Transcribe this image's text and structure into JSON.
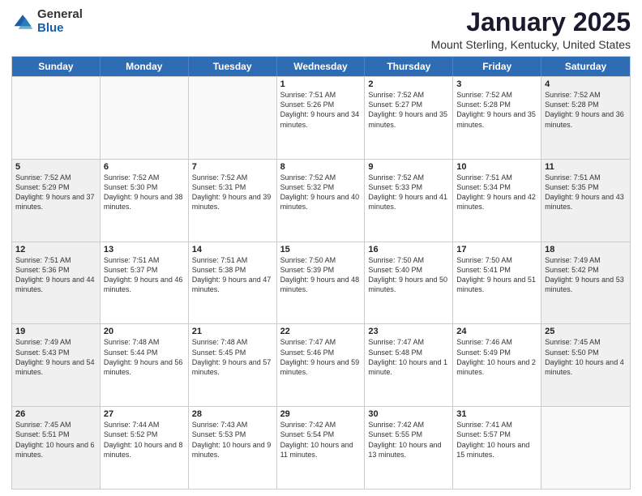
{
  "logo": {
    "general": "General",
    "blue": "Blue"
  },
  "title": "January 2025",
  "subtitle": "Mount Sterling, Kentucky, United States",
  "days": [
    "Sunday",
    "Monday",
    "Tuesday",
    "Wednesday",
    "Thursday",
    "Friday",
    "Saturday"
  ],
  "weeks": [
    [
      {
        "day": "",
        "text": ""
      },
      {
        "day": "",
        "text": ""
      },
      {
        "day": "",
        "text": ""
      },
      {
        "day": "1",
        "text": "Sunrise: 7:51 AM\nSunset: 5:26 PM\nDaylight: 9 hours and 34 minutes."
      },
      {
        "day": "2",
        "text": "Sunrise: 7:52 AM\nSunset: 5:27 PM\nDaylight: 9 hours and 35 minutes."
      },
      {
        "day": "3",
        "text": "Sunrise: 7:52 AM\nSunset: 5:28 PM\nDaylight: 9 hours and 35 minutes."
      },
      {
        "day": "4",
        "text": "Sunrise: 7:52 AM\nSunset: 5:28 PM\nDaylight: 9 hours and 36 minutes."
      }
    ],
    [
      {
        "day": "5",
        "text": "Sunrise: 7:52 AM\nSunset: 5:29 PM\nDaylight: 9 hours and 37 minutes."
      },
      {
        "day": "6",
        "text": "Sunrise: 7:52 AM\nSunset: 5:30 PM\nDaylight: 9 hours and 38 minutes."
      },
      {
        "day": "7",
        "text": "Sunrise: 7:52 AM\nSunset: 5:31 PM\nDaylight: 9 hours and 39 minutes."
      },
      {
        "day": "8",
        "text": "Sunrise: 7:52 AM\nSunset: 5:32 PM\nDaylight: 9 hours and 40 minutes."
      },
      {
        "day": "9",
        "text": "Sunrise: 7:52 AM\nSunset: 5:33 PM\nDaylight: 9 hours and 41 minutes."
      },
      {
        "day": "10",
        "text": "Sunrise: 7:51 AM\nSunset: 5:34 PM\nDaylight: 9 hours and 42 minutes."
      },
      {
        "day": "11",
        "text": "Sunrise: 7:51 AM\nSunset: 5:35 PM\nDaylight: 9 hours and 43 minutes."
      }
    ],
    [
      {
        "day": "12",
        "text": "Sunrise: 7:51 AM\nSunset: 5:36 PM\nDaylight: 9 hours and 44 minutes."
      },
      {
        "day": "13",
        "text": "Sunrise: 7:51 AM\nSunset: 5:37 PM\nDaylight: 9 hours and 46 minutes."
      },
      {
        "day": "14",
        "text": "Sunrise: 7:51 AM\nSunset: 5:38 PM\nDaylight: 9 hours and 47 minutes."
      },
      {
        "day": "15",
        "text": "Sunrise: 7:50 AM\nSunset: 5:39 PM\nDaylight: 9 hours and 48 minutes."
      },
      {
        "day": "16",
        "text": "Sunrise: 7:50 AM\nSunset: 5:40 PM\nDaylight: 9 hours and 50 minutes."
      },
      {
        "day": "17",
        "text": "Sunrise: 7:50 AM\nSunset: 5:41 PM\nDaylight: 9 hours and 51 minutes."
      },
      {
        "day": "18",
        "text": "Sunrise: 7:49 AM\nSunset: 5:42 PM\nDaylight: 9 hours and 53 minutes."
      }
    ],
    [
      {
        "day": "19",
        "text": "Sunrise: 7:49 AM\nSunset: 5:43 PM\nDaylight: 9 hours and 54 minutes."
      },
      {
        "day": "20",
        "text": "Sunrise: 7:48 AM\nSunset: 5:44 PM\nDaylight: 9 hours and 56 minutes."
      },
      {
        "day": "21",
        "text": "Sunrise: 7:48 AM\nSunset: 5:45 PM\nDaylight: 9 hours and 57 minutes."
      },
      {
        "day": "22",
        "text": "Sunrise: 7:47 AM\nSunset: 5:46 PM\nDaylight: 9 hours and 59 minutes."
      },
      {
        "day": "23",
        "text": "Sunrise: 7:47 AM\nSunset: 5:48 PM\nDaylight: 10 hours and 1 minute."
      },
      {
        "day": "24",
        "text": "Sunrise: 7:46 AM\nSunset: 5:49 PM\nDaylight: 10 hours and 2 minutes."
      },
      {
        "day": "25",
        "text": "Sunrise: 7:45 AM\nSunset: 5:50 PM\nDaylight: 10 hours and 4 minutes."
      }
    ],
    [
      {
        "day": "26",
        "text": "Sunrise: 7:45 AM\nSunset: 5:51 PM\nDaylight: 10 hours and 6 minutes."
      },
      {
        "day": "27",
        "text": "Sunrise: 7:44 AM\nSunset: 5:52 PM\nDaylight: 10 hours and 8 minutes."
      },
      {
        "day": "28",
        "text": "Sunrise: 7:43 AM\nSunset: 5:53 PM\nDaylight: 10 hours and 9 minutes."
      },
      {
        "day": "29",
        "text": "Sunrise: 7:42 AM\nSunset: 5:54 PM\nDaylight: 10 hours and 11 minutes."
      },
      {
        "day": "30",
        "text": "Sunrise: 7:42 AM\nSunset: 5:55 PM\nDaylight: 10 hours and 13 minutes."
      },
      {
        "day": "31",
        "text": "Sunrise: 7:41 AM\nSunset: 5:57 PM\nDaylight: 10 hours and 15 minutes."
      },
      {
        "day": "",
        "text": ""
      }
    ]
  ]
}
